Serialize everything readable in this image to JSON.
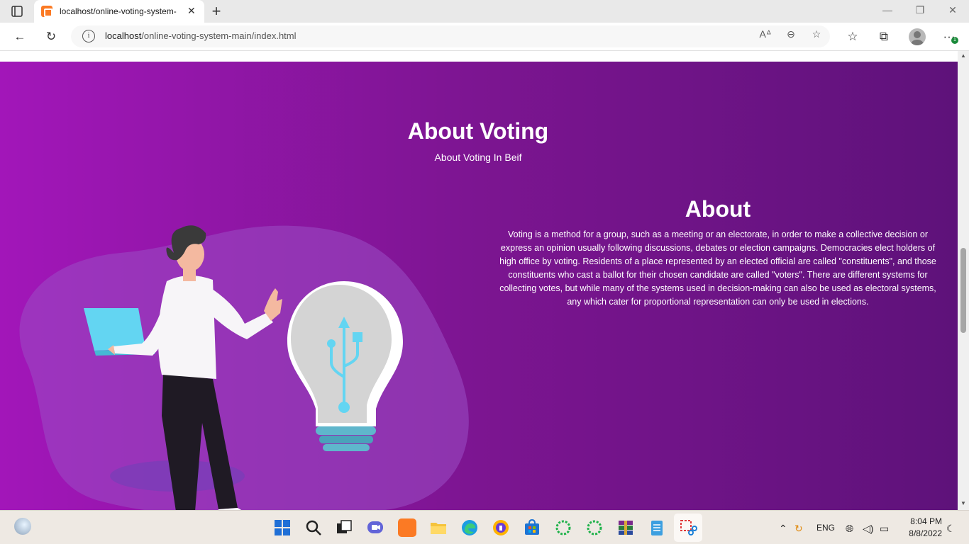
{
  "browser": {
    "tab_title": "localhost/online-voting-system-",
    "tab_close": "✕",
    "new_tab": "+",
    "url_host": "localhost",
    "url_path": "/online-voting-system-main/index.html",
    "profile_badge": "1"
  },
  "hero": {
    "title": "About Voting",
    "subtitle": "About Voting In Beif"
  },
  "about": {
    "title": "About",
    "body": "Voting is a method for a group, such as a meeting or an electorate, in order to make a collective decision or express an opinion usually following discussions, debates or election campaigns. Democracies elect holders of high office by voting. Residents of a place represented by an elected official are called \"constituents\", and those constituents who cast a ballot for their chosen candidate are called \"voters\". There are different systems for collecting votes, but while many of the systems used in decision-making can also be used as electoral systems, any which cater for proportional representation can only be used in elections."
  },
  "taskbar": {
    "language": "ENG",
    "time": "8:04 PM",
    "date": "8/8/2022"
  },
  "colors": {
    "hero_left": "#a216b9",
    "hero_right": "#5e127a",
    "blob": "#9a4fc4",
    "usb_blue": "#63d5f2"
  },
  "icons": [
    "tab-actions-icon",
    "back-icon",
    "refresh-icon",
    "info-icon",
    "read-aloud-icon",
    "zoom-out-icon",
    "add-favorite-icon",
    "favorites-icon",
    "collections-icon",
    "profile-icon",
    "more-icon",
    "windows-start-icon",
    "search-icon",
    "task-view-icon",
    "teams-chat-icon",
    "xampp-icon",
    "file-explorer-icon",
    "edge-icon",
    "vpn-icon",
    "store-icon",
    "loader-icon",
    "winrar-icon",
    "notepad-icon",
    "snipping-tool-icon",
    "chevron-up-icon",
    "sync-icon",
    "globe-icon",
    "volume-icon",
    "battery-icon",
    "moon-icon"
  ]
}
